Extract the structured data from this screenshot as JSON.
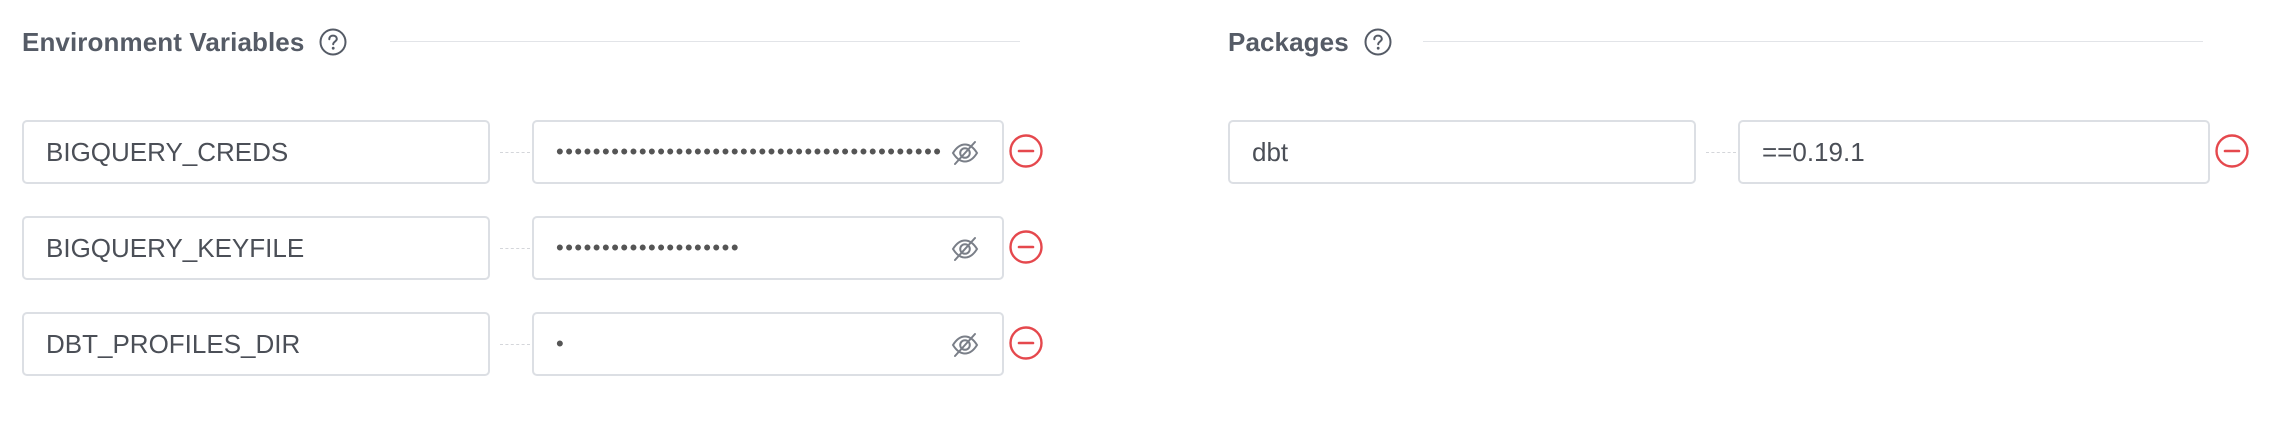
{
  "environment_variables": {
    "title": "Environment Variables",
    "help_icon": "question-circle-icon",
    "rows": [
      {
        "name": "BIGQUERY_CREDS",
        "value": "••••••••••••••••••••••••••••••••••••••••••"
      },
      {
        "name": "BIGQUERY_KEYFILE",
        "value": "••••••••••••••••••••"
      },
      {
        "name": "DBT_PROFILES_DIR",
        "value": "•"
      }
    ],
    "visibility_icon": "eye-slash-icon",
    "remove_icon": "minus-circle-icon"
  },
  "packages": {
    "title": "Packages",
    "help_icon": "question-circle-icon",
    "rows": [
      {
        "name": "dbt",
        "version": "==0.19.1"
      }
    ],
    "remove_icon": "minus-circle-icon"
  },
  "colors": {
    "remove": "#e5484d",
    "border": "#dcdfe4",
    "title": "#555b66"
  }
}
